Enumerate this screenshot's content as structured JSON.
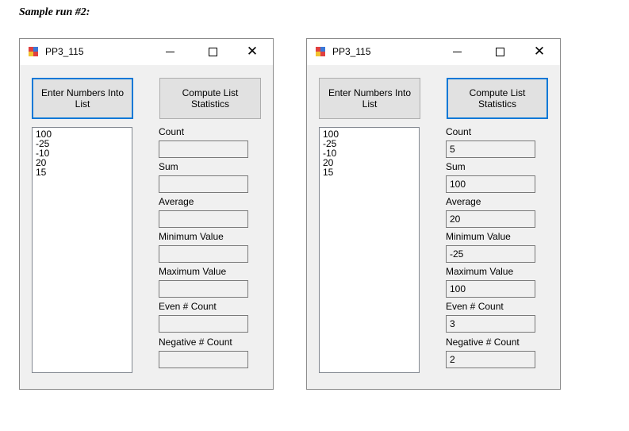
{
  "caption": "Sample run #2:",
  "colors": {
    "focus_border": "#0078d7",
    "window_bg": "#f0f0f0",
    "titlebar_bg": "#ffffff",
    "button_bg": "#e1e1e1"
  },
  "windows": [
    {
      "title": "PP3_115",
      "controls": {
        "minimize_icon": "minimize-icon",
        "maximize_icon": "maximize-icon",
        "close": "✕"
      },
      "enter_button": "Enter Numbers Into List",
      "compute_button": "Compute List Statistics",
      "focused_button": "enter",
      "list_items": [
        "100",
        "-25",
        "-10",
        "20",
        "15"
      ],
      "fields": [
        {
          "label": "Count",
          "value": ""
        },
        {
          "label": "Sum",
          "value": ""
        },
        {
          "label": "Average",
          "value": ""
        },
        {
          "label": "Minimum Value",
          "value": ""
        },
        {
          "label": "Maximum Value",
          "value": ""
        },
        {
          "label": "Even # Count",
          "value": ""
        },
        {
          "label": "Negative # Count",
          "value": ""
        }
      ]
    },
    {
      "title": "PP3_115",
      "controls": {
        "minimize_icon": "minimize-icon",
        "maximize_icon": "maximize-icon",
        "close": "✕"
      },
      "enter_button": "Enter Numbers Into List",
      "compute_button": "Compute List Statistics",
      "focused_button": "compute",
      "list_items": [
        "100",
        "-25",
        "-10",
        "20",
        "15"
      ],
      "fields": [
        {
          "label": "Count",
          "value": "5"
        },
        {
          "label": "Sum",
          "value": "100"
        },
        {
          "label": "Average",
          "value": "20"
        },
        {
          "label": "Minimum Value",
          "value": "-25"
        },
        {
          "label": "Maximum Value",
          "value": "100"
        },
        {
          "label": "Even # Count",
          "value": "3"
        },
        {
          "label": "Negative # Count",
          "value": "2"
        }
      ]
    }
  ]
}
